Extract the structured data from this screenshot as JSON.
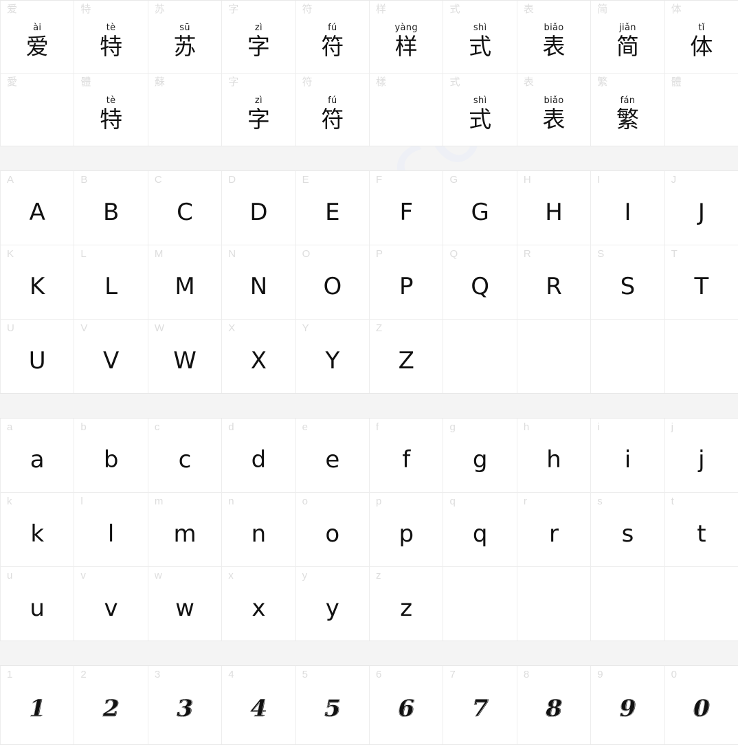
{
  "watermark": {
    "text": "aitesu.com",
    "color": "#eef0f6"
  },
  "colors": {
    "page_background": "#f4f4f4",
    "cell_background": "#ffffff",
    "grid_line": "#ededed",
    "corner_label": "#dddddd",
    "glyph": "#111111"
  },
  "sections": [
    {
      "name": "chinese-sample",
      "rows": [
        {
          "name": "simplified-row",
          "cells": [
            {
              "label": "爱",
              "pinyin": "ài",
              "glyph": "爱"
            },
            {
              "label": "特",
              "pinyin": "tè",
              "glyph": "特"
            },
            {
              "label": "苏",
              "pinyin": "sū",
              "glyph": "苏"
            },
            {
              "label": "字",
              "pinyin": "zì",
              "glyph": "字"
            },
            {
              "label": "符",
              "pinyin": "fú",
              "glyph": "符"
            },
            {
              "label": "样",
              "pinyin": "yàng",
              "glyph": "样"
            },
            {
              "label": "式",
              "pinyin": "shì",
              "glyph": "式"
            },
            {
              "label": "表",
              "pinyin": "biǎo",
              "glyph": "表"
            },
            {
              "label": "简",
              "pinyin": "jiǎn",
              "glyph": "简"
            },
            {
              "label": "体",
              "pinyin": "tǐ",
              "glyph": "体"
            }
          ]
        },
        {
          "name": "traditional-row",
          "cells": [
            {
              "label": "愛",
              "pinyin": "",
              "glyph": ""
            },
            {
              "label": "體",
              "pinyin": "tè",
              "glyph": "特"
            },
            {
              "label": "蘇",
              "pinyin": "",
              "glyph": ""
            },
            {
              "label": "字",
              "pinyin": "zì",
              "glyph": "字"
            },
            {
              "label": "符",
              "pinyin": "fú",
              "glyph": "符"
            },
            {
              "label": "樣",
              "pinyin": "",
              "glyph": ""
            },
            {
              "label": "式",
              "pinyin": "shì",
              "glyph": "式"
            },
            {
              "label": "表",
              "pinyin": "biǎo",
              "glyph": "表"
            },
            {
              "label": "繁",
              "pinyin": "fán",
              "glyph": "繁"
            },
            {
              "label": "體",
              "pinyin": "",
              "glyph": ""
            }
          ]
        }
      ]
    },
    {
      "name": "uppercase-latin",
      "rows": [
        {
          "name": "uppercase-row-1",
          "cells": [
            {
              "label": "A",
              "glyph": "A"
            },
            {
              "label": "B",
              "glyph": "B"
            },
            {
              "label": "C",
              "glyph": "C"
            },
            {
              "label": "D",
              "glyph": "D"
            },
            {
              "label": "E",
              "glyph": "E"
            },
            {
              "label": "F",
              "glyph": "F"
            },
            {
              "label": "G",
              "glyph": "G"
            },
            {
              "label": "H",
              "glyph": "H"
            },
            {
              "label": "I",
              "glyph": "I"
            },
            {
              "label": "J",
              "glyph": "J"
            }
          ]
        },
        {
          "name": "uppercase-row-2",
          "cells": [
            {
              "label": "K",
              "glyph": "K"
            },
            {
              "label": "L",
              "glyph": "L"
            },
            {
              "label": "M",
              "glyph": "M"
            },
            {
              "label": "N",
              "glyph": "N"
            },
            {
              "label": "O",
              "glyph": "O"
            },
            {
              "label": "P",
              "glyph": "P"
            },
            {
              "label": "Q",
              "glyph": "Q"
            },
            {
              "label": "R",
              "glyph": "R"
            },
            {
              "label": "S",
              "glyph": "S"
            },
            {
              "label": "T",
              "glyph": "T"
            }
          ]
        },
        {
          "name": "uppercase-row-3",
          "cells": [
            {
              "label": "U",
              "glyph": "U"
            },
            {
              "label": "V",
              "glyph": "V"
            },
            {
              "label": "W",
              "glyph": "W"
            },
            {
              "label": "X",
              "glyph": "X"
            },
            {
              "label": "Y",
              "glyph": "Y"
            },
            {
              "label": "Z",
              "glyph": "Z"
            },
            {
              "label": "",
              "glyph": ""
            },
            {
              "label": "",
              "glyph": ""
            },
            {
              "label": "",
              "glyph": ""
            },
            {
              "label": "",
              "glyph": ""
            }
          ]
        }
      ]
    },
    {
      "name": "lowercase-latin",
      "rows": [
        {
          "name": "lowercase-row-1",
          "cells": [
            {
              "label": "a",
              "glyph": "a"
            },
            {
              "label": "b",
              "glyph": "b"
            },
            {
              "label": "c",
              "glyph": "c"
            },
            {
              "label": "d",
              "glyph": "d"
            },
            {
              "label": "e",
              "glyph": "e"
            },
            {
              "label": "f",
              "glyph": "f"
            },
            {
              "label": "g",
              "glyph": "g"
            },
            {
              "label": "h",
              "glyph": "h"
            },
            {
              "label": "i",
              "glyph": "i"
            },
            {
              "label": "j",
              "glyph": "j"
            }
          ]
        },
        {
          "name": "lowercase-row-2",
          "cells": [
            {
              "label": "k",
              "glyph": "k"
            },
            {
              "label": "l",
              "glyph": "l"
            },
            {
              "label": "m",
              "glyph": "m"
            },
            {
              "label": "n",
              "glyph": "n"
            },
            {
              "label": "o",
              "glyph": "o"
            },
            {
              "label": "p",
              "glyph": "p"
            },
            {
              "label": "q",
              "glyph": "q"
            },
            {
              "label": "r",
              "glyph": "r"
            },
            {
              "label": "s",
              "glyph": "s"
            },
            {
              "label": "t",
              "glyph": "t"
            }
          ]
        },
        {
          "name": "lowercase-row-3",
          "cells": [
            {
              "label": "u",
              "glyph": "u"
            },
            {
              "label": "v",
              "glyph": "v"
            },
            {
              "label": "w",
              "glyph": "w"
            },
            {
              "label": "x",
              "glyph": "x"
            },
            {
              "label": "y",
              "glyph": "y"
            },
            {
              "label": "z",
              "glyph": "z"
            },
            {
              "label": "",
              "glyph": ""
            },
            {
              "label": "",
              "glyph": ""
            },
            {
              "label": "",
              "glyph": ""
            },
            {
              "label": "",
              "glyph": ""
            }
          ]
        }
      ]
    },
    {
      "name": "digits",
      "rows": [
        {
          "name": "digits-row",
          "cells": [
            {
              "label": "1",
              "glyph": "1"
            },
            {
              "label": "2",
              "glyph": "2"
            },
            {
              "label": "3",
              "glyph": "3"
            },
            {
              "label": "4",
              "glyph": "4"
            },
            {
              "label": "5",
              "glyph": "5"
            },
            {
              "label": "6",
              "glyph": "6"
            },
            {
              "label": "7",
              "glyph": "7"
            },
            {
              "label": "8",
              "glyph": "8"
            },
            {
              "label": "9",
              "glyph": "9"
            },
            {
              "label": "0",
              "glyph": "0"
            }
          ]
        }
      ]
    }
  ]
}
